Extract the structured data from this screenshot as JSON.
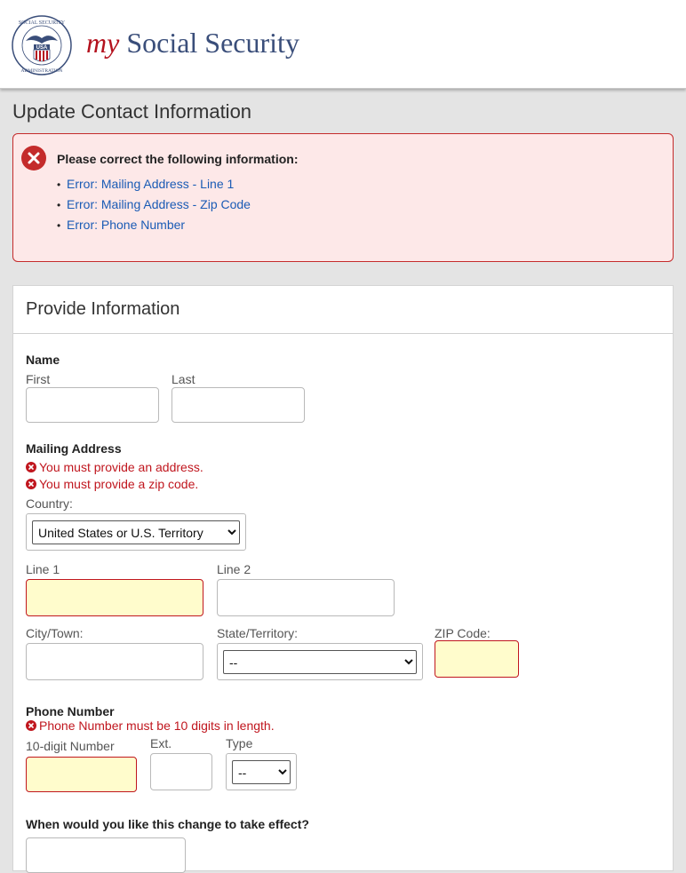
{
  "header": {
    "brand_my": "my",
    "brand_name": "Social Security",
    "seal": {
      "top_text": "SOCIAL SECURITY",
      "bottom_text": "ADMINISTRATION",
      "center_text": "USA"
    }
  },
  "page_title": "Update Contact Information",
  "error_summary": {
    "heading": "Please correct the following information:",
    "items": [
      "Error: Mailing Address - Line 1",
      "Error: Mailing Address - Zip Code",
      "Error: Phone Number"
    ]
  },
  "form": {
    "title": "Provide Information",
    "name": {
      "label": "Name",
      "first_label": "First",
      "first_value": "",
      "last_label": "Last",
      "last_value": ""
    },
    "mailing": {
      "label": "Mailing Address",
      "errors": [
        "You must provide an address.",
        "You must provide a zip code."
      ],
      "country_label": "Country:",
      "country_value": "United States or U.S. Territory",
      "line1_label": "Line 1",
      "line2_label": "Line 2",
      "city_label": "City/Town:",
      "state_label": "State/Territory:",
      "state_value": "--",
      "zip_label": "ZIP Code:"
    },
    "phone": {
      "label": "Phone Number",
      "error": "Phone Number must be 10 digits in length.",
      "number_label": "10-digit Number",
      "ext_label": "Ext.",
      "type_label": "Type",
      "type_value": "--"
    },
    "effective": {
      "label": "When would you like this change to take effect?"
    }
  },
  "colors": {
    "error_red": "#c0161e",
    "link_blue": "#1a5bb5",
    "brand_blue": "#3a4e7a",
    "error_field_bg": "#fffccc",
    "error_box_bg": "#fde8e8"
  }
}
